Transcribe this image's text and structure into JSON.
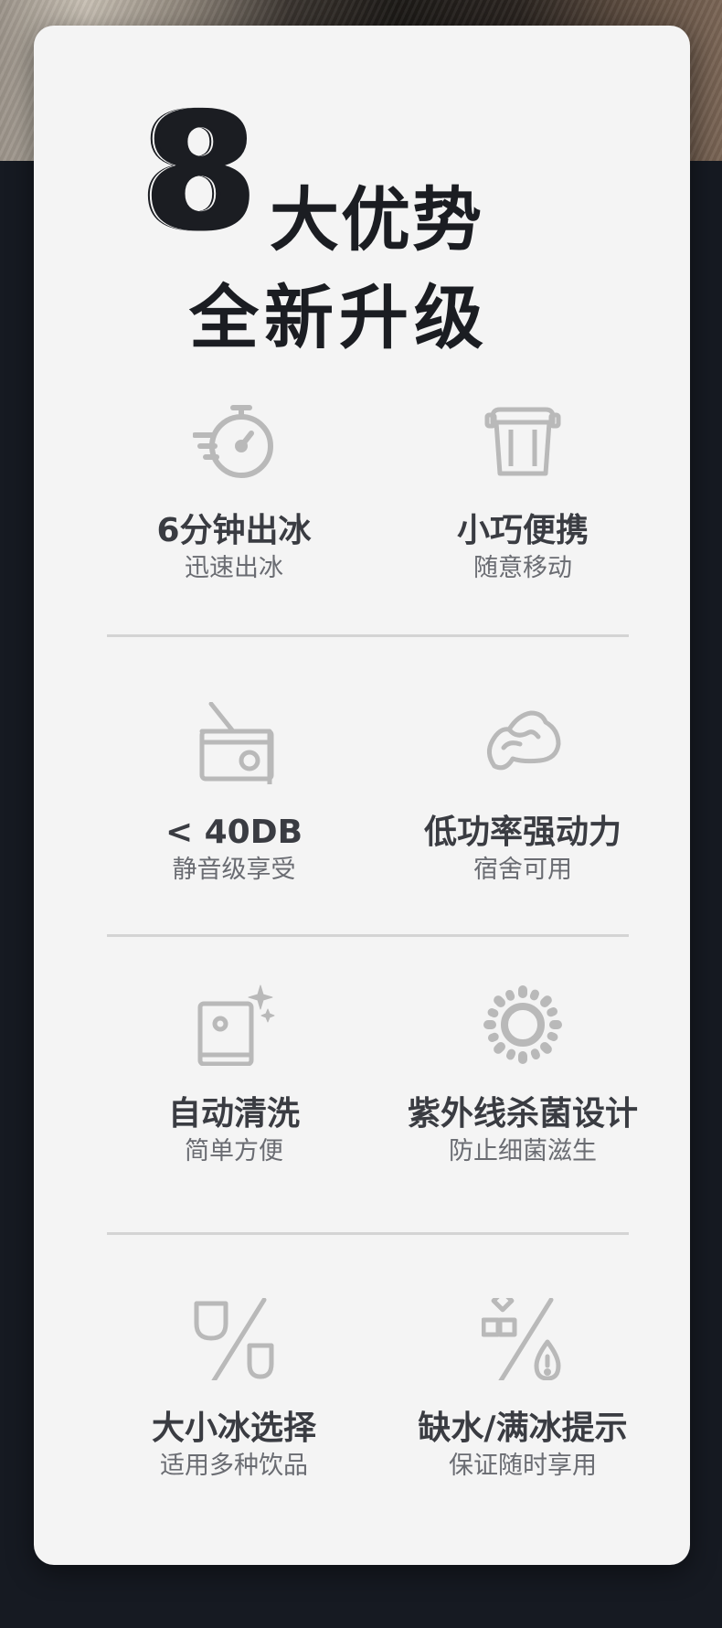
{
  "header": {
    "number": "8",
    "title_line1": "大优势",
    "title_line2": "全新升级"
  },
  "features": [
    {
      "title": "6分钟出冰",
      "subtitle": "迅速出冰",
      "icon": "stopwatch-icon"
    },
    {
      "title": "小巧便携",
      "subtitle": "随意移动",
      "icon": "container-icon"
    },
    {
      "title": "< 40DB",
      "subtitle": "静音级享受",
      "icon": "radio-icon"
    },
    {
      "title": "低功率强动力",
      "subtitle": "宿舍可用",
      "icon": "arm-strength-icon"
    },
    {
      "title": "自动清洗",
      "subtitle": "简单方便",
      "icon": "sparkle-panel-icon"
    },
    {
      "title": "紫外线杀菌设计",
      "subtitle": "防止细菌滋生",
      "icon": "sun-icon"
    },
    {
      "title": "大小冰选择",
      "subtitle": "适用多种饮品",
      "icon": "ice-size-icon"
    },
    {
      "title": "缺水/满冰提示",
      "subtitle": "保证随时享用",
      "icon": "water-alert-icon"
    }
  ],
  "colors": {
    "background": "#161a22",
    "card": "#f4f4f4",
    "title": "#1b1d22",
    "icon": "#b9b9b9",
    "divider": "#d4d4d4"
  }
}
